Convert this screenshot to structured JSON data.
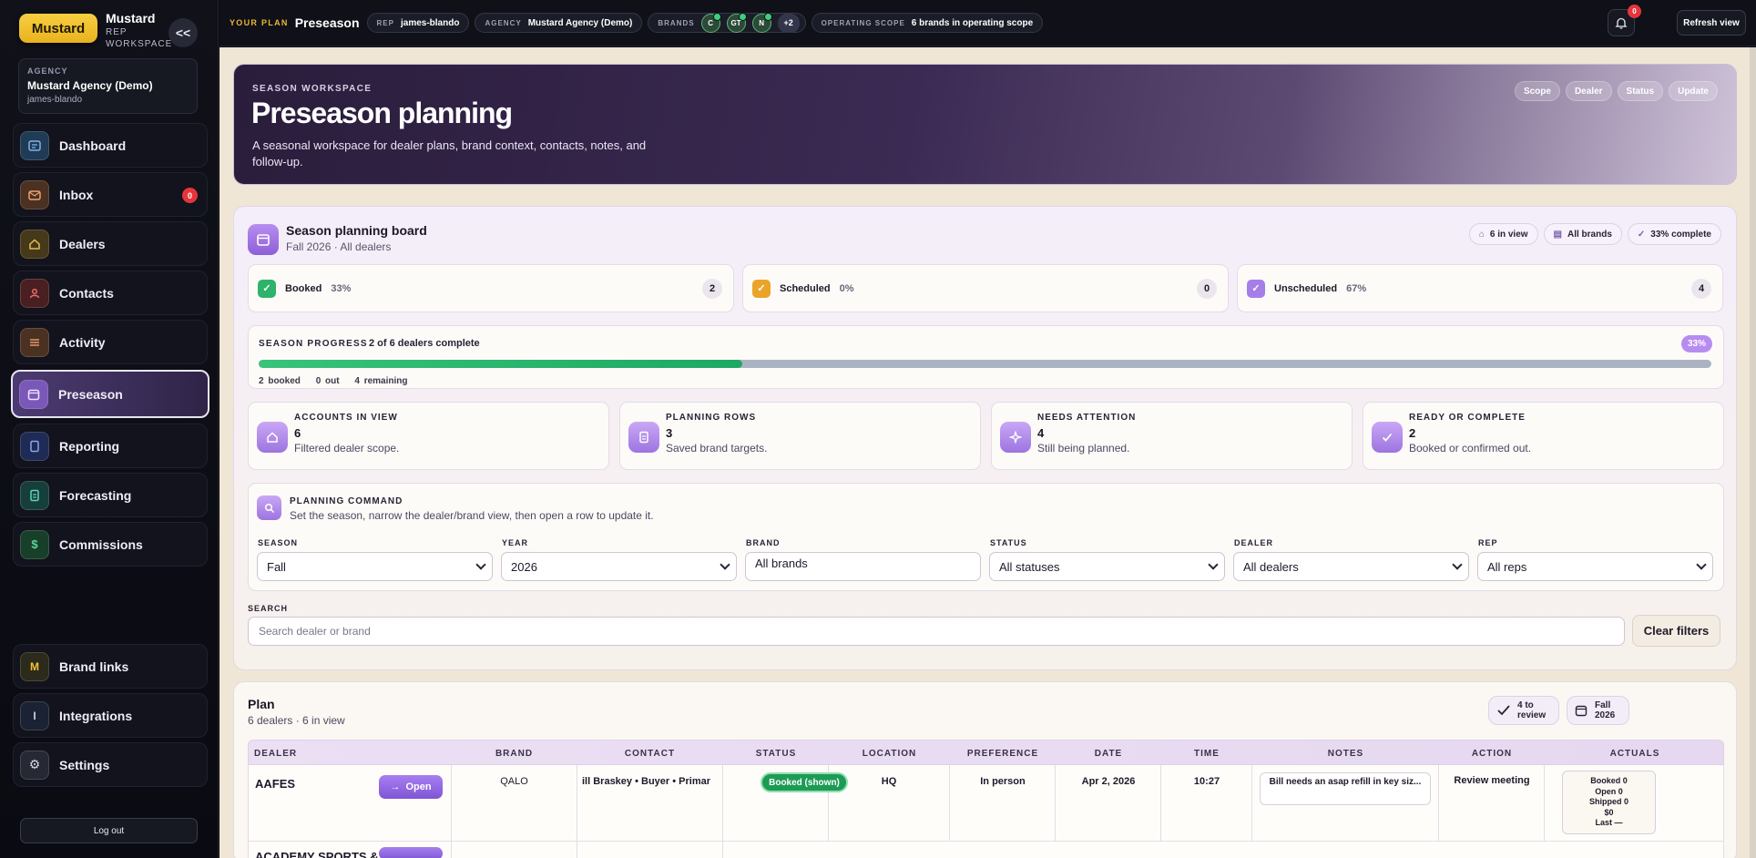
{
  "sidebar": {
    "brand_pill": "Mustard",
    "workspace_title": "Mustard",
    "workspace_sub": "REP WORKSPACE",
    "collapse_label": "<<",
    "agency": {
      "label": "AGENCY",
      "name": "Mustard Agency (Demo)",
      "user": "james-blando"
    },
    "items": [
      {
        "label": "Dashboard",
        "icon": "dashboard-icon",
        "color": "#4a8fd1"
      },
      {
        "label": "Inbox",
        "icon": "inbox-icon",
        "color": "#d9875a",
        "badge": "0"
      },
      {
        "label": "Dealers",
        "icon": "home-icon",
        "color": "#c9a23e"
      },
      {
        "label": "Contacts",
        "icon": "contacts-icon",
        "color": "#d9534f"
      },
      {
        "label": "Activity",
        "icon": "activity-icon",
        "color": "#d9875a"
      },
      {
        "label": "Preseason",
        "icon": "calendar-icon",
        "color": "#a67ee8"
      },
      {
        "label": "Reporting",
        "icon": "reporting-icon",
        "color": "#5b7ee0"
      },
      {
        "label": "Forecasting",
        "icon": "forecast-icon",
        "color": "#3fb8a6"
      },
      {
        "label": "Commissions",
        "icon": "dollar-icon",
        "color": "#3fb87a"
      }
    ],
    "bottom_items": [
      {
        "label": "Brand links",
        "glyph": "M"
      },
      {
        "label": "Integrations",
        "glyph": "I"
      },
      {
        "label": "Settings",
        "glyph": "⚙"
      }
    ],
    "logout": "Log out"
  },
  "topbar": {
    "plan_label": "YOUR PLAN",
    "plan_value": "Preseason",
    "rep_label": "REP",
    "rep_value": "james-blando",
    "agency_label": "AGENCY",
    "agency_value": "Mustard Agency (Demo)",
    "brands_label": "BRANDS",
    "brand_badges": [
      "C",
      "GT",
      "N"
    ],
    "brand_more": "+2",
    "scope_label": "OPERATING SCOPE",
    "scope_value": "6 brands in operating scope",
    "bell_badge": "0",
    "refresh": "Refresh view"
  },
  "hero": {
    "kicker": "SEASON WORKSPACE",
    "title": "Preseason planning",
    "desc": "A seasonal workspace for dealer plans, brand context, contacts, notes, and follow-up.",
    "pills": [
      "Scope",
      "Dealer",
      "Status",
      "Update"
    ]
  },
  "board": {
    "title": "Season planning board",
    "sub": "Fall 2026 · All dealers",
    "chips": [
      "6 in view",
      "All brands",
      "33% complete"
    ],
    "stats": [
      {
        "name": "Booked",
        "pct": "33%",
        "count": "2",
        "color": "#2fb36a"
      },
      {
        "name": "Scheduled",
        "pct": "0%",
        "count": "0",
        "color": "#eaa42a"
      },
      {
        "name": "Unscheduled",
        "pct": "67%",
        "count": "4",
        "color": "#a67ee8"
      }
    ],
    "progress": {
      "label": "SEASON PROGRESS",
      "value": "2 of 6 dealers complete",
      "badge": "33%",
      "fraction": 0.333,
      "foot": [
        "2 booked",
        "0 out",
        "4 remaining"
      ]
    },
    "metrics": [
      {
        "label": "ACCOUNTS IN VIEW",
        "value": "6",
        "desc": "Filtered dealer scope."
      },
      {
        "label": "PLANNING ROWS",
        "value": "3",
        "desc": "Saved brand targets."
      },
      {
        "label": "NEEDS ATTENTION",
        "value": "4",
        "desc": "Still being planned."
      },
      {
        "label": "READY OR COMPLETE",
        "value": "2",
        "desc": "Booked or confirmed out."
      }
    ],
    "command": {
      "label": "PLANNING COMMAND",
      "desc": "Set the season, narrow the dealer/brand view, then open a row to update it."
    },
    "filters": [
      {
        "label": "SEASON",
        "value": "Fall",
        "type": "select"
      },
      {
        "label": "YEAR",
        "value": "2026",
        "type": "select"
      },
      {
        "label": "BRAND",
        "value": "All brands",
        "type": "input"
      },
      {
        "label": "STATUS",
        "value": "All statuses",
        "type": "select"
      },
      {
        "label": "DEALER",
        "value": "All dealers",
        "type": "select"
      },
      {
        "label": "REP",
        "value": "All reps",
        "type": "select"
      }
    ],
    "search_label": "SEARCH",
    "search_placeholder": "Search dealer or brand",
    "clear": "Clear filters"
  },
  "plan": {
    "title": "Plan",
    "sub": "6 dealers · 6 in view",
    "review_chip": "4 to review",
    "season_chip": "Fall 2026",
    "columns": [
      "DEALER",
      "BRAND",
      "CONTACT",
      "STATUS",
      "LOCATION",
      "PREFERENCE",
      "DATE",
      "TIME",
      "NOTES",
      "ACTION",
      "ACTUALS"
    ],
    "rows": [
      {
        "dealer": "AAFES",
        "open": "Open",
        "brand": "QALO",
        "contact": "ill Braskey • Buyer • Primar",
        "status": "Booked (shown)",
        "location": "HQ",
        "preference": "In person",
        "date": "Apr 2, 2026",
        "time": "10:27",
        "notes": "Bill needs an asap refill in key siz...",
        "action": "Review meeting",
        "actuals": [
          "Booked 0",
          "Open 0",
          "Shipped 0",
          "$0",
          "Last —"
        ]
      },
      {
        "dealer": "ACADEMY SPORTS &"
      }
    ]
  }
}
